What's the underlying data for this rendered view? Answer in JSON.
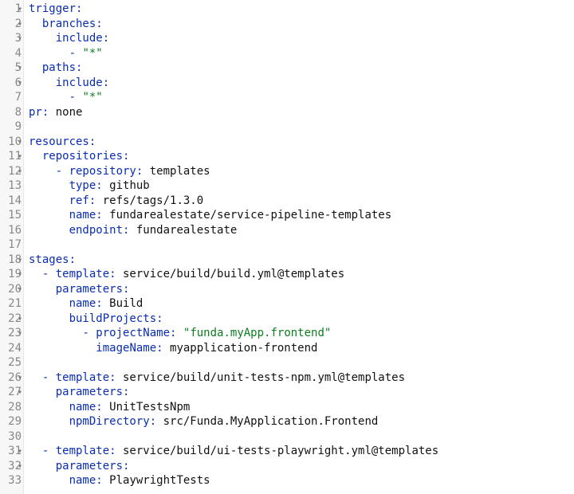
{
  "lines": [
    {
      "n": 1,
      "fold": true,
      "tokens": [
        [
          "k",
          "trigger:"
        ]
      ]
    },
    {
      "n": 2,
      "fold": true,
      "tokens": [
        [
          "v",
          "  "
        ],
        [
          "k",
          "branches:"
        ]
      ]
    },
    {
      "n": 3,
      "fold": true,
      "tokens": [
        [
          "v",
          "    "
        ],
        [
          "k",
          "include:"
        ]
      ]
    },
    {
      "n": 4,
      "fold": false,
      "tokens": [
        [
          "v",
          "      "
        ],
        [
          "d",
          "- "
        ],
        [
          "s",
          "\"*\""
        ]
      ]
    },
    {
      "n": 5,
      "fold": true,
      "tokens": [
        [
          "v",
          "  "
        ],
        [
          "k",
          "paths:"
        ]
      ]
    },
    {
      "n": 6,
      "fold": true,
      "tokens": [
        [
          "v",
          "    "
        ],
        [
          "k",
          "include:"
        ]
      ]
    },
    {
      "n": 7,
      "fold": false,
      "tokens": [
        [
          "v",
          "      "
        ],
        [
          "d",
          "- "
        ],
        [
          "s",
          "\"*\""
        ]
      ]
    },
    {
      "n": 8,
      "fold": false,
      "tokens": [
        [
          "k",
          "pr:"
        ],
        [
          "v",
          " none"
        ]
      ]
    },
    {
      "n": 9,
      "fold": false,
      "tokens": [
        [
          "v",
          ""
        ]
      ]
    },
    {
      "n": 10,
      "fold": true,
      "tokens": [
        [
          "k",
          "resources:"
        ]
      ]
    },
    {
      "n": 11,
      "fold": true,
      "tokens": [
        [
          "v",
          "  "
        ],
        [
          "k",
          "repositories:"
        ]
      ]
    },
    {
      "n": 12,
      "fold": true,
      "tokens": [
        [
          "v",
          "    "
        ],
        [
          "d",
          "- "
        ],
        [
          "k",
          "repository:"
        ],
        [
          "v",
          " templates"
        ]
      ]
    },
    {
      "n": 13,
      "fold": false,
      "tokens": [
        [
          "v",
          "      "
        ],
        [
          "k",
          "type:"
        ],
        [
          "v",
          " github"
        ]
      ]
    },
    {
      "n": 14,
      "fold": false,
      "tokens": [
        [
          "v",
          "      "
        ],
        [
          "k",
          "ref:"
        ],
        [
          "v",
          " refs/tags/1.3.0"
        ]
      ]
    },
    {
      "n": 15,
      "fold": false,
      "tokens": [
        [
          "v",
          "      "
        ],
        [
          "k",
          "name:"
        ],
        [
          "v",
          " fundarealestate/service-pipeline-templates"
        ]
      ]
    },
    {
      "n": 16,
      "fold": false,
      "tokens": [
        [
          "v",
          "      "
        ],
        [
          "k",
          "endpoint:"
        ],
        [
          "v",
          " fundarealestate"
        ]
      ]
    },
    {
      "n": 17,
      "fold": false,
      "tokens": [
        [
          "v",
          ""
        ]
      ]
    },
    {
      "n": 18,
      "fold": true,
      "tokens": [
        [
          "k",
          "stages:"
        ]
      ]
    },
    {
      "n": 19,
      "fold": true,
      "tokens": [
        [
          "v",
          "  "
        ],
        [
          "d",
          "- "
        ],
        [
          "k",
          "template:"
        ],
        [
          "v",
          " service/build/build.yml@templates"
        ]
      ]
    },
    {
      "n": 20,
      "fold": true,
      "tokens": [
        [
          "v",
          "    "
        ],
        [
          "k",
          "parameters:"
        ]
      ]
    },
    {
      "n": 21,
      "fold": false,
      "tokens": [
        [
          "v",
          "      "
        ],
        [
          "k",
          "name:"
        ],
        [
          "v",
          " Build"
        ]
      ]
    },
    {
      "n": 22,
      "fold": true,
      "tokens": [
        [
          "v",
          "      "
        ],
        [
          "k",
          "buildProjects:"
        ]
      ]
    },
    {
      "n": 23,
      "fold": true,
      "tokens": [
        [
          "v",
          "        "
        ],
        [
          "d",
          "- "
        ],
        [
          "k",
          "projectName:"
        ],
        [
          "v",
          " "
        ],
        [
          "s",
          "\"funda.myApp.frontend\""
        ]
      ]
    },
    {
      "n": 24,
      "fold": false,
      "tokens": [
        [
          "v",
          "          "
        ],
        [
          "k",
          "imageName:"
        ],
        [
          "v",
          " myapplication-frontend"
        ]
      ]
    },
    {
      "n": 25,
      "fold": false,
      "tokens": [
        [
          "v",
          ""
        ]
      ]
    },
    {
      "n": 26,
      "fold": true,
      "tokens": [
        [
          "v",
          "  "
        ],
        [
          "d",
          "- "
        ],
        [
          "k",
          "template:"
        ],
        [
          "v",
          " service/build/unit-tests-npm.yml@templates"
        ]
      ]
    },
    {
      "n": 27,
      "fold": true,
      "tokens": [
        [
          "v",
          "    "
        ],
        [
          "k",
          "parameters:"
        ]
      ]
    },
    {
      "n": 28,
      "fold": false,
      "tokens": [
        [
          "v",
          "      "
        ],
        [
          "k",
          "name:"
        ],
        [
          "v",
          " UnitTestsNpm"
        ]
      ]
    },
    {
      "n": 29,
      "fold": false,
      "tokens": [
        [
          "v",
          "      "
        ],
        [
          "k",
          "npmDirectory:"
        ],
        [
          "v",
          " src/Funda.MyApplication.Frontend"
        ]
      ]
    },
    {
      "n": 30,
      "fold": false,
      "tokens": [
        [
          "v",
          ""
        ]
      ]
    },
    {
      "n": 31,
      "fold": true,
      "tokens": [
        [
          "v",
          "  "
        ],
        [
          "d",
          "- "
        ],
        [
          "k",
          "template:"
        ],
        [
          "v",
          " service/build/ui-tests-playwright.yml@templates"
        ]
      ]
    },
    {
      "n": 32,
      "fold": true,
      "tokens": [
        [
          "v",
          "    "
        ],
        [
          "k",
          "parameters:"
        ]
      ]
    },
    {
      "n": 33,
      "fold": false,
      "tokens": [
        [
          "v",
          "      "
        ],
        [
          "k",
          "name:"
        ],
        [
          "v",
          " PlaywrightTests"
        ]
      ]
    }
  ],
  "foldGlyph": "▾"
}
